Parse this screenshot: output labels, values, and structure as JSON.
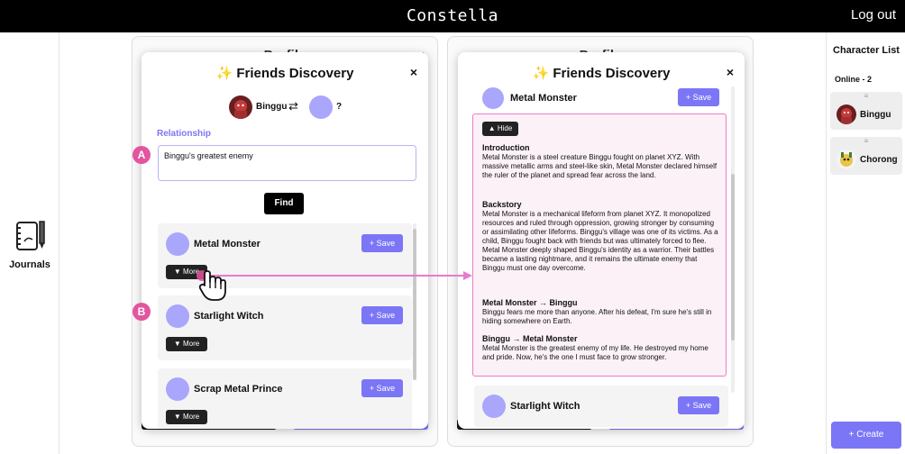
{
  "app": {
    "title": "Constella",
    "logout_label": "Log out"
  },
  "left_rail": {
    "journals_label": "Journals",
    "journals_icon": "journal-icon"
  },
  "right_rail": {
    "title": "Character List",
    "online_label": "Online - 2",
    "characters": [
      {
        "name": "Binggu",
        "handle": "≡"
      },
      {
        "name": "Chorong",
        "handle": "≡"
      }
    ],
    "create_label": "+ Create"
  },
  "background_panel": {
    "title": "Profile",
    "close": "×"
  },
  "discovery": {
    "title_icon": "✨",
    "title": "Friends Discovery",
    "close": "×",
    "source_name": "Binggu",
    "swap_icon": "⇄",
    "target_name": "?",
    "relationship_label": "Relationship",
    "relationship_value": "Binggu's greatest enemy",
    "find_label": "Find",
    "save_label": "+ Save",
    "more_label": "▼ More",
    "hide_label": "▲ Hide",
    "results": [
      {
        "name": "Metal Monster"
      },
      {
        "name": "Starlight Witch"
      },
      {
        "name": "Scrap Metal Prince"
      }
    ]
  },
  "detail": {
    "name": "Metal Monster",
    "next_name": "Starlight Witch",
    "sections": [
      {
        "heading": "Introduction",
        "text": "Metal Monster is a steel creature Binggu fought on planet XYZ. With massive metallic arms and steel-like skin, Metal Monster declared himself the ruler of the planet and spread fear across the land."
      },
      {
        "heading": "Backstory",
        "text": "Metal Monster is a mechanical lifeform from planet XYZ. It monopolized resources and ruled through oppression, growing stronger by consuming or assimilating other lifeforms. Binggu's village was one of its victims. As a child, Binggu fought back with friends but was ultimately forced to flee. Metal Monster deeply shaped Binggu's identity as a warrior. Their battles became a lasting nightmare, and it remains the ultimate enemy that Binggu must one day overcome."
      },
      {
        "heading": "Metal Monster → Binggu",
        "text": "Binggu fears me more than anyone. After his defeat, I'm sure he's still in hiding somewhere on Earth."
      },
      {
        "heading": "Binggu → Metal Monster",
        "text": "Metal Monster is the greatest enemy of my life. He destroyed my home and pride. Now, he's the one I must face to grow stronger."
      }
    ]
  },
  "annotations": {
    "a": "A",
    "b": "B"
  },
  "colors": {
    "accent": "#7b76f6",
    "highlight": "#e2559f",
    "topbar": "#000000"
  }
}
